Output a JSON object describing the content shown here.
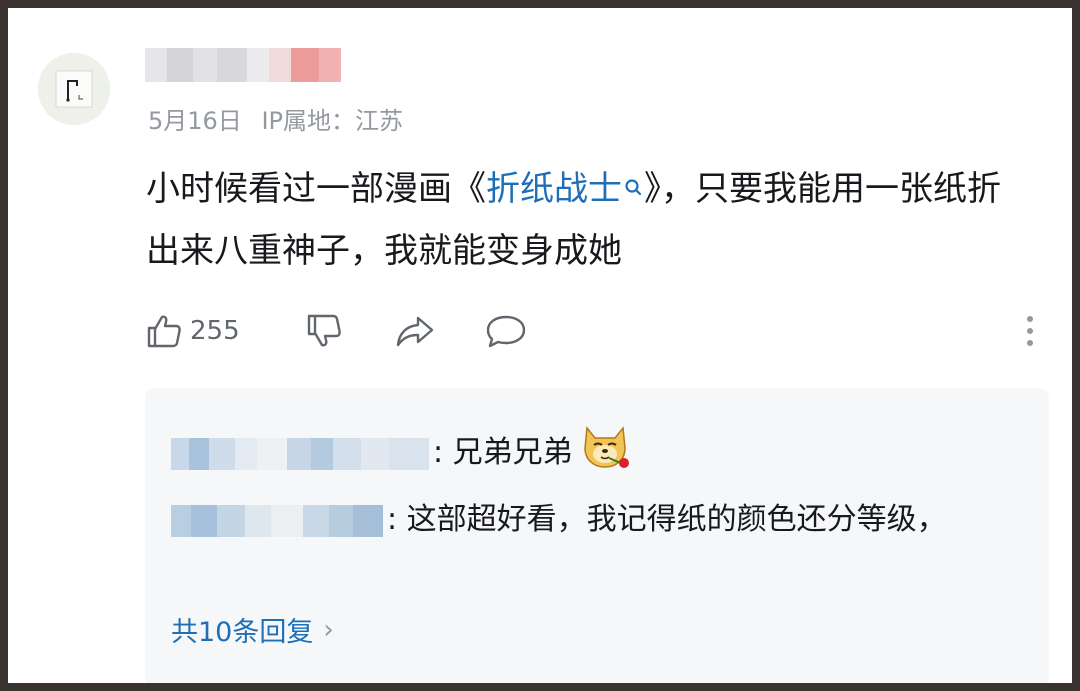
{
  "comment": {
    "date": "5月16日",
    "ip_location": "IP属地：江苏",
    "text_before": "小时候看过一部漫画《",
    "link_text": "折纸战士",
    "text_after": "》，只要我能用一张纸折出来八重神子，我就能变身成她",
    "like_count": "255"
  },
  "icons": {
    "like": "thumb-up-icon",
    "dislike": "thumb-down-icon",
    "share": "share-arrow-icon",
    "reply": "speech-bubble-icon",
    "more": "vertical-ellipsis-icon",
    "search": "magnifier-icon",
    "emoji": "doge-rose-emoji-icon"
  },
  "replies": [
    {
      "text": ": 兄弟兄弟"
    },
    {
      "text": ": 这部超好看，我记得纸的颜色还分等级，"
    }
  ],
  "more_replies": "共10条回复",
  "colors": {
    "link": "#1e6fb8",
    "meta": "#9499a0",
    "text": "#18191c",
    "reply_bg": "#f6f7f8",
    "frame": "#3a3330"
  }
}
